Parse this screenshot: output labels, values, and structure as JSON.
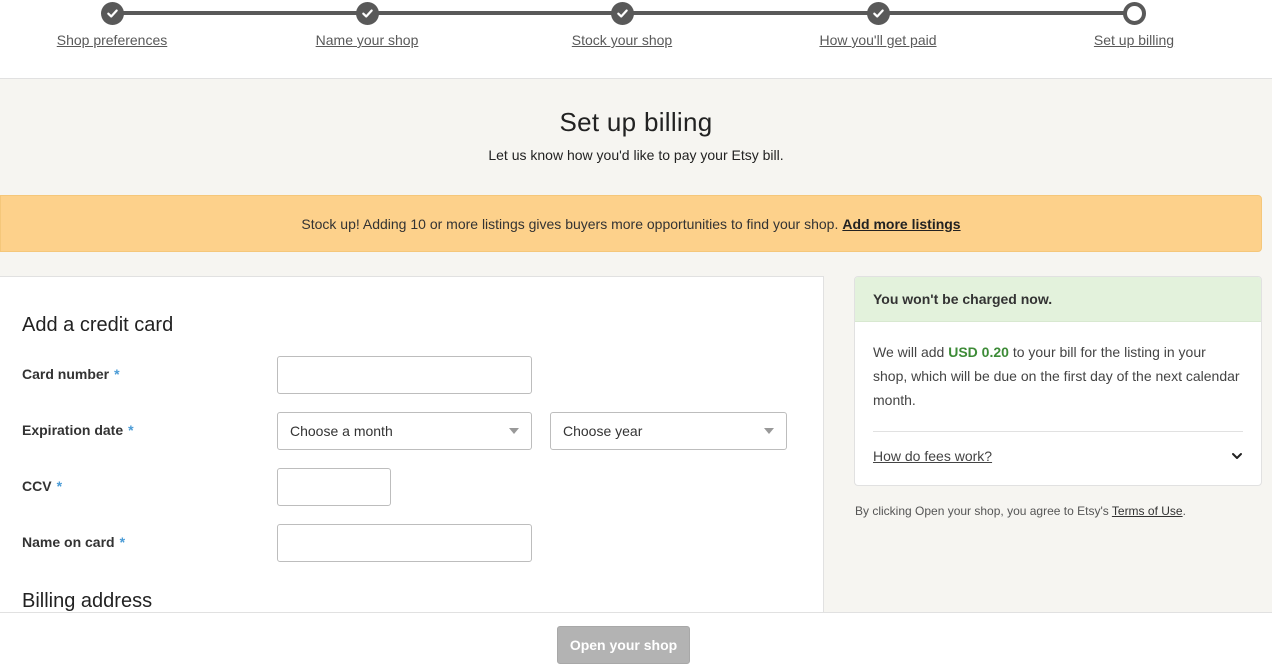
{
  "progress": {
    "steps": [
      {
        "label": "Shop preferences",
        "state": "complete"
      },
      {
        "label": "Name your shop",
        "state": "complete"
      },
      {
        "label": "Stock your shop",
        "state": "complete"
      },
      {
        "label": "How you'll get paid",
        "state": "complete"
      },
      {
        "label": "Set up billing",
        "state": "current"
      }
    ],
    "icons": {
      "complete": "check-icon",
      "current": "ring-icon"
    }
  },
  "page": {
    "title": "Set up billing",
    "subtitle": "Let us know how you'd like to pay your Etsy bill."
  },
  "banner": {
    "text": "Stock up! Adding 10 or more listings gives buyers more opportunities to find your shop.",
    "link": "Add more listings",
    "color": "#fdd18b"
  },
  "credit_card": {
    "heading": "Add a credit card",
    "required_marker": "*",
    "card_number": {
      "label": "Card number",
      "value": ""
    },
    "expiration": {
      "label": "Expiration date",
      "month": {
        "selected": "Choose a month"
      },
      "year": {
        "selected": "Choose year"
      }
    },
    "ccv": {
      "label": "CCV",
      "value": ""
    },
    "name_on_card": {
      "label": "Name on card",
      "value": ""
    }
  },
  "billing_address": {
    "heading": "Billing address"
  },
  "info": {
    "header": "You won't be charged now.",
    "header_color": "#e3f2dc",
    "text_before": "We will add",
    "amount": "USD 0.20",
    "amount_color": "#3d8b37",
    "text_after": "to your bill for the listing in your shop, which will be due on the first day of the next calendar month.",
    "fees_link": "How do fees work?",
    "fees_icon": "chevron-down-icon"
  },
  "terms": {
    "text": "By clicking Open your shop, you agree to Etsy's",
    "link": "Terms of Use",
    "period": "."
  },
  "footer": {
    "open_button": "Open your shop"
  }
}
